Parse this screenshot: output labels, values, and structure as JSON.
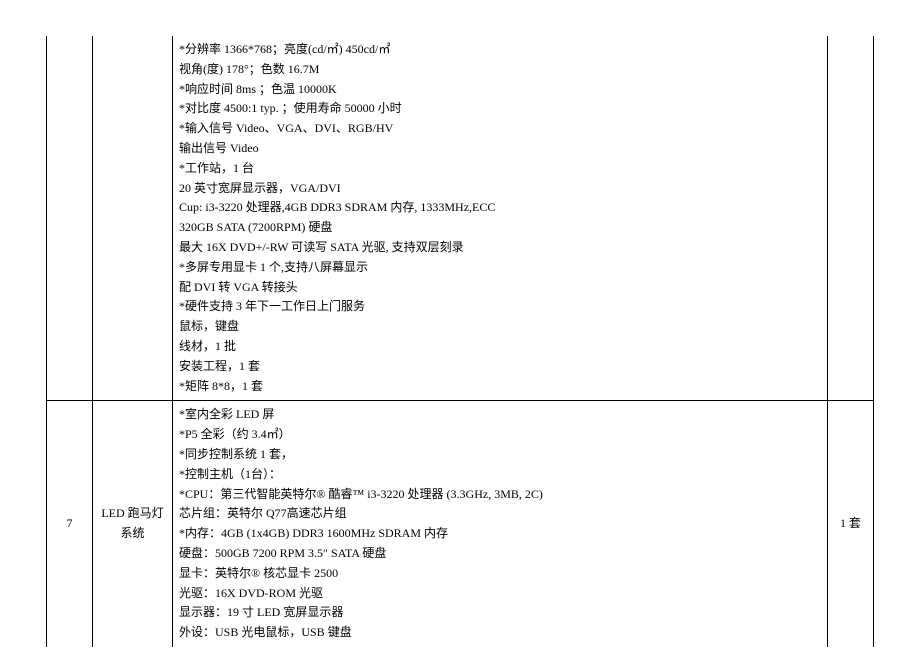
{
  "rows": [
    {
      "idx": "",
      "name": "",
      "spec": "*分辨率 1366*768；亮度(cd/㎡) 450cd/㎡\n视角(度) 178°；色数 16.7M\n*响应时间 8ms ；色温 10000K\n*对比度 4500:1 typ. ；使用寿命 50000 小时\n*输入信号 Video、VGA、DVI、RGB/HV\n输出信号 Video\n*工作站，1 台\n20 英寸宽屏显示器，VGA/DVI\nCup: i3-3220 处理器,4GB DDR3 SDRAM 内存, 1333MHz,ECC\n320GB SATA (7200RPM) 硬盘\n最大 16X DVD+/-RW 可读写 SATA 光驱, 支持双层刻录\n*多屏专用显卡 1 个,支持八屏幕显示\n配 DVI 转 VGA 转接头\n*硬件支持 3 年下一工作日上门服务\n鼠标，键盘\n线材，1 批\n安装工程，1 套\n*矩阵 8*8，1 套",
      "qty": ""
    },
    {
      "idx": "7",
      "name": "LED 跑马灯系统",
      "spec": "*室内全彩 LED 屏\n*P5 全彩（约 3.4㎡）\n*同步控制系统 1 套，\n*控制主机（1台）：\n*CPU：第三代智能英特尔® 酷睿™ i3-3220 处理器 (3.3GHz, 3MB, 2C)\n芯片组：英特尔 Q77高速芯片组\n*内存：4GB (1x4GB) DDR3 1600MHz SDRAM 内存\n硬盘：500GB 7200 RPM 3.5″ SATA 硬盘\n显卡：英特尔® 核芯显卡 2500\n光驱：16X DVD-ROM 光驱\n显示器：19 寸 LED 宽屏显示器\n外设：USB 光电鼠标，USB 键盘",
      "qty": "1 套"
    }
  ]
}
